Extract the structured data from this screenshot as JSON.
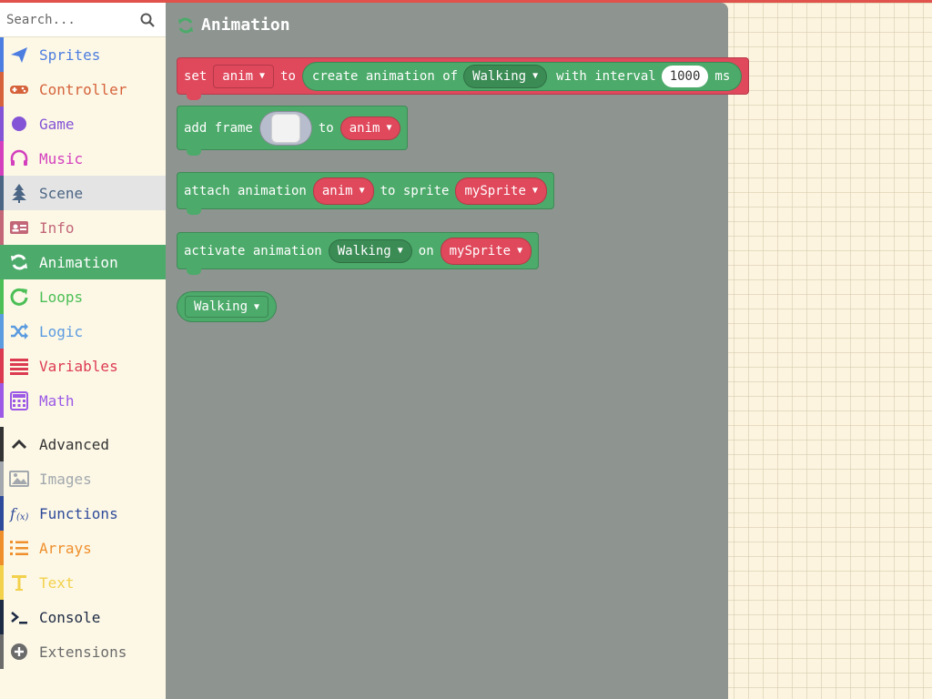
{
  "search": {
    "placeholder": "Search..."
  },
  "categories": [
    {
      "label": "Sprites",
      "color": "#4c7de0",
      "icon": "paper-plane-icon"
    },
    {
      "label": "Controller",
      "color": "#d5623a",
      "icon": "gamepad-icon"
    },
    {
      "label": "Game",
      "color": "#8454d6",
      "icon": "circle-icon"
    },
    {
      "label": "Music",
      "color": "#d33fbd",
      "icon": "headphones-icon"
    },
    {
      "label": "Scene",
      "color": "#4b6584",
      "icon": "tree-icon"
    },
    {
      "label": "Info",
      "color": "#c26678",
      "icon": "id-card-icon"
    },
    {
      "label": "Animation",
      "color": "#4caa6a",
      "icon": "refresh-icon"
    },
    {
      "label": "Loops",
      "color": "#4cbf56",
      "icon": "loop-icon"
    },
    {
      "label": "Logic",
      "color": "#5b9be0",
      "icon": "shuffle-icon"
    },
    {
      "label": "Variables",
      "color": "#dc3a51",
      "icon": "list-bars-icon"
    },
    {
      "label": "Math",
      "color": "#9b59e6",
      "icon": "calculator-icon"
    },
    {
      "label": "Advanced",
      "color": "#333333",
      "icon": "chevron-up-icon"
    },
    {
      "label": "Images",
      "color": "#a2a8ad",
      "icon": "image-icon"
    },
    {
      "label": "Functions",
      "color": "#2e4a9a",
      "icon": "function-icon"
    },
    {
      "label": "Arrays",
      "color": "#ef8f2c",
      "icon": "list-ol-icon"
    },
    {
      "label": "Text",
      "color": "#f2d14b",
      "icon": "text-icon"
    },
    {
      "label": "Console",
      "color": "#1d2a44",
      "icon": "terminal-icon"
    },
    {
      "label": "Extensions",
      "color": "#6b6b6b",
      "icon": "plus-circle-icon"
    }
  ],
  "flyout": {
    "title": "Animation",
    "set_block": {
      "set": "set",
      "var": "anim",
      "to": "to",
      "create": "create animation of",
      "anim": "Walking",
      "interval_label": "with interval",
      "interval": "1000",
      "unit": "ms"
    },
    "add_frame": {
      "label": "add frame",
      "to": "to",
      "var": "anim"
    },
    "attach": {
      "label": "attach animation",
      "var": "anim",
      "to_sprite": "to sprite",
      "sprite": "mySprite"
    },
    "activate": {
      "label": "activate animation",
      "anim": "Walking",
      "on": "on",
      "sprite": "mySprite"
    },
    "reporter": {
      "anim": "Walking"
    }
  }
}
